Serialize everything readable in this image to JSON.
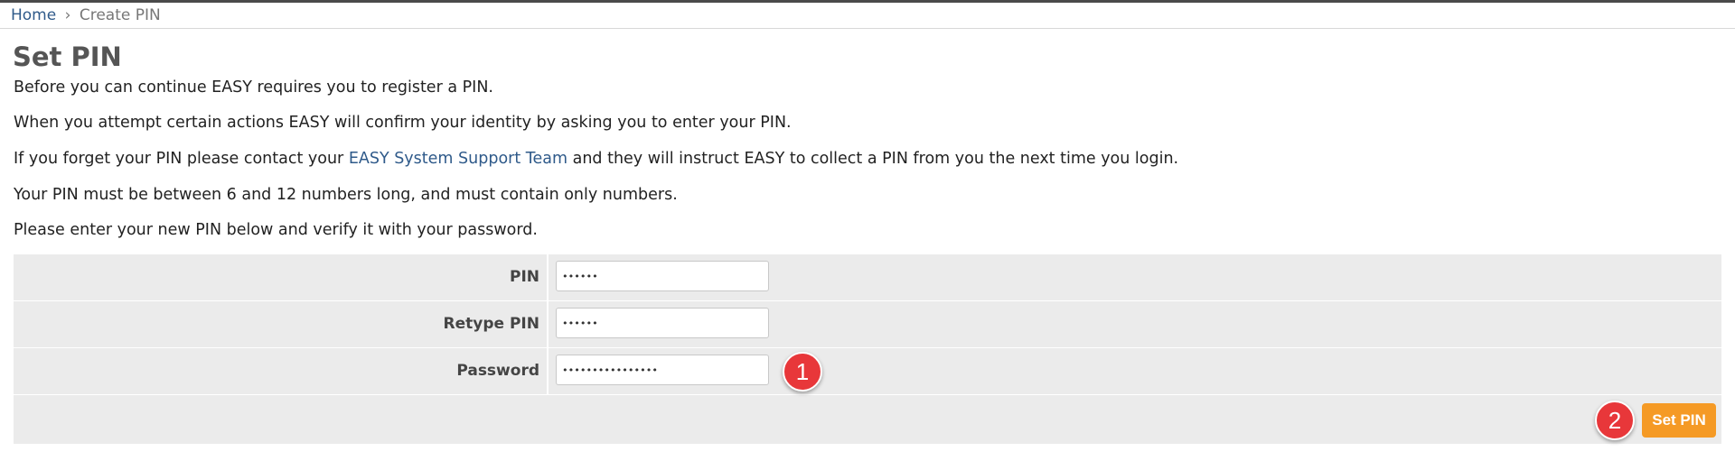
{
  "breadcrumb": {
    "home": "Home",
    "separator": "›",
    "current": "Create PIN"
  },
  "page": {
    "title": "Set PIN"
  },
  "intro": {
    "line1": "Before you can continue EASY requires you to register a PIN.",
    "line2": "When you attempt certain actions EASY will confirm your identity by asking you to enter your PIN.",
    "line3_before": "If you forget your PIN please contact your ",
    "line3_link": "EASY System Support Team",
    "line3_after": " and they will instruct EASY to collect a PIN from you the next time you login.",
    "line4": "Your PIN must be between 6 and 12 numbers long, and must contain only numbers.",
    "line5": "Please enter your new PIN below and verify it with your password."
  },
  "form": {
    "pin": {
      "label": "PIN",
      "value": "••••••"
    },
    "retype_pin": {
      "label": "Retype PIN",
      "value": "••••••"
    },
    "password": {
      "label": "Password",
      "value": "••••••••••••••••"
    },
    "submit_label": "Set PIN"
  },
  "annotations": {
    "step1": "1",
    "step2": "2"
  },
  "colors": {
    "link": "#2f5a8a",
    "button": "#f59a25",
    "marker": "#e8373a",
    "table_bg": "#ebebeb"
  }
}
